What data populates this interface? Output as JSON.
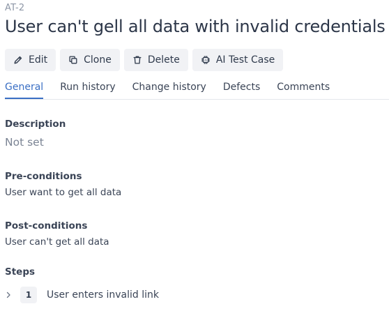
{
  "case": {
    "key": "AT-2",
    "title": "User can't gell all data with invalid credentials"
  },
  "toolbar": {
    "edit_label": "Edit",
    "edit_icon": "pencil-icon",
    "clone_label": "Clone",
    "clone_icon": "copy-icon",
    "delete_label": "Delete",
    "delete_icon": "trash-icon",
    "ai_label": "AI Test Case",
    "ai_icon": "chip-icon"
  },
  "tabs": [
    {
      "label": "General",
      "active": true
    },
    {
      "label": "Run history",
      "active": false
    },
    {
      "label": "Change history",
      "active": false
    },
    {
      "label": "Defects",
      "active": false
    },
    {
      "label": "Comments",
      "active": false
    }
  ],
  "sections": {
    "description": {
      "label": "Description",
      "value": "Not set"
    },
    "preconditions": {
      "label": "Pre-conditions",
      "value": "User want to get all data"
    },
    "postconditions": {
      "label": "Post-conditions",
      "value": "User can't get all data"
    },
    "steps": {
      "label": "Steps",
      "items": [
        {
          "number": "1",
          "text": "User enters invalid link",
          "icon": "chevron-right-icon"
        }
      ]
    }
  },
  "colors": {
    "accent": "#3a6fc4",
    "button_bg": "#f1f2f5",
    "text": "#2f3a4c",
    "muted": "#8d96a6"
  }
}
